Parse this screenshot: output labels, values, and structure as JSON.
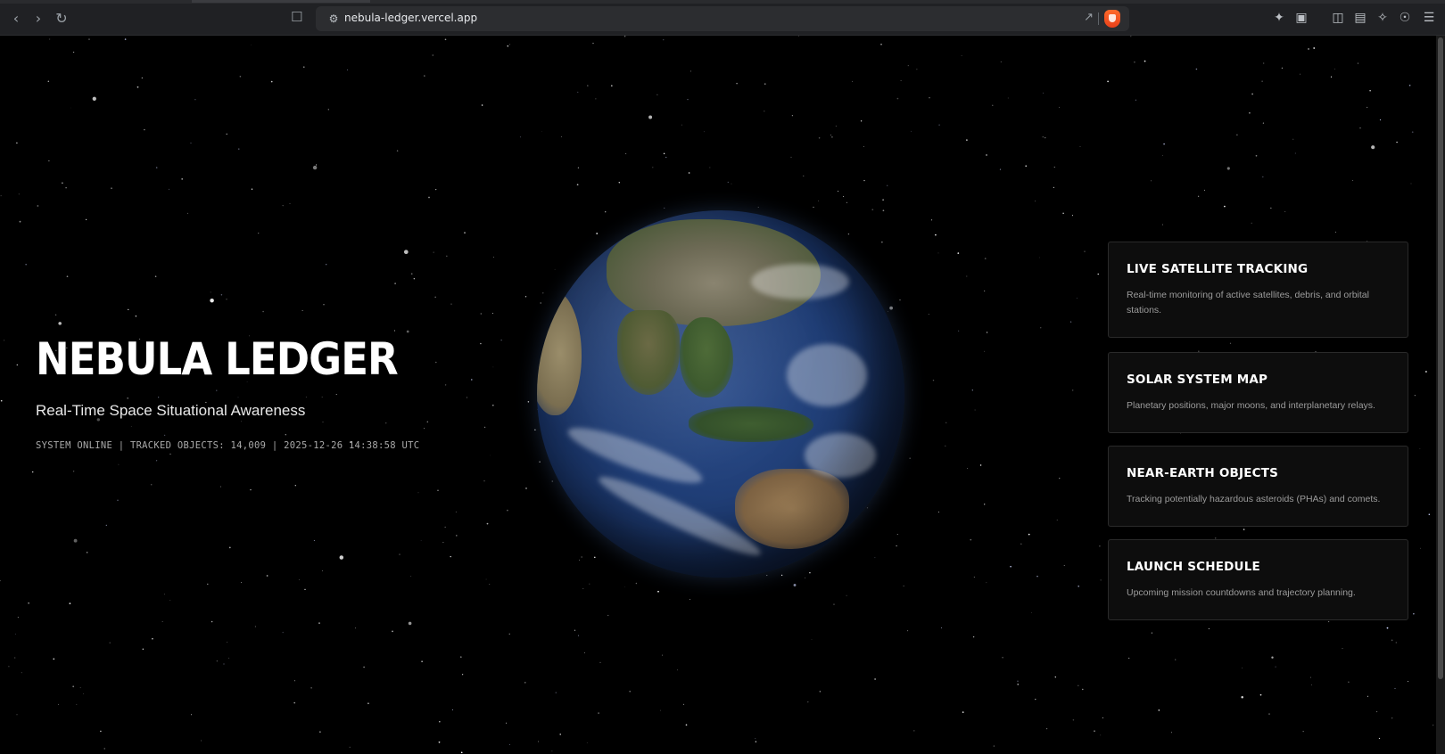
{
  "browser": {
    "url": "nebula-ledger.vercel.app",
    "icons": [
      "back-icon",
      "forward-icon",
      "reload-icon",
      "bookmark-icon",
      "site-settings-icon",
      "share-icon",
      "brave-shield-icon",
      "extensions-icon",
      "screenshot-icon",
      "sidebar-icon",
      "wallet-icon",
      "leo-ai-icon",
      "vpn-icon",
      "menu-icon"
    ]
  },
  "hero": {
    "title": "NEBULA LEDGER",
    "subtitle": "Real-Time Space Situational Awareness",
    "status": "SYSTEM ONLINE | TRACKED OBJECTS: 14,009 | 2025-12-26 14:38:58 UTC"
  },
  "cards": [
    {
      "title": "LIVE SATELLITE TRACKING",
      "description": "Real-time monitoring of active satellites, debris, and orbital stations."
    },
    {
      "title": "SOLAR SYSTEM MAP",
      "description": "Planetary positions, major moons, and interplanetary relays."
    },
    {
      "title": "NEAR-EARTH OBJECTS",
      "description": "Tracking potentially hazardous asteroids (PHAs) and comets."
    },
    {
      "title": "LAUNCH SCHEDULE",
      "description": "Upcoming mission countdowns and trajectory planning."
    }
  ],
  "colors": {
    "background": "#000000",
    "card_background": "#0d0d0d",
    "card_border": "#2a2a2a",
    "status_text": "#a9a9a9",
    "brave_orange": "#fb542b"
  }
}
